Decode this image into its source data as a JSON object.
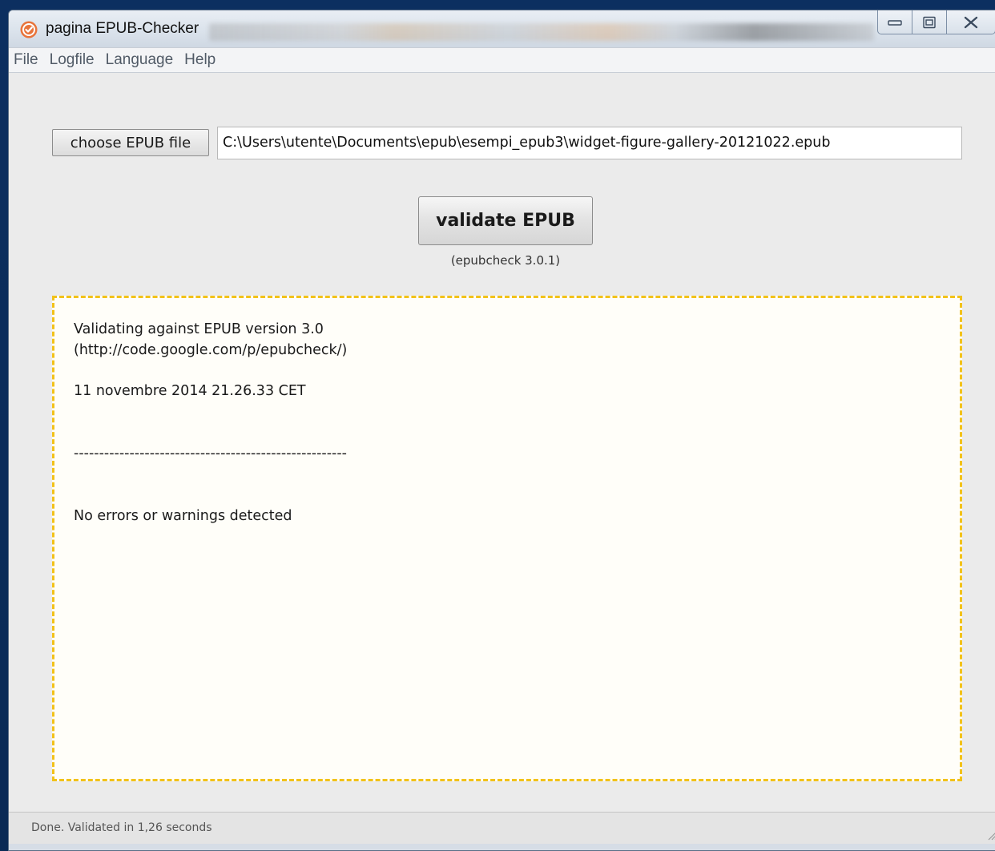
{
  "window": {
    "title": "pagina EPUB-Checker"
  },
  "icons": {
    "app": "epub-checker-logo-icon",
    "minimize": "minimize-icon",
    "maximize": "maximize-icon",
    "close": "close-icon"
  },
  "menu": {
    "items": [
      {
        "label": "File"
      },
      {
        "label": "Logfile"
      },
      {
        "label": "Language"
      },
      {
        "label": "Help"
      }
    ]
  },
  "file_picker": {
    "button_label": "choose EPUB file",
    "path": "C:\\Users\\utente\\Documents\\epub\\esempi_epub3\\widget-figure-gallery-20121022.epub"
  },
  "validate": {
    "button_label": "validate EPUB",
    "version": "(epubcheck 3.0.1)"
  },
  "log": {
    "line1": "Validating against EPUB version 3.0",
    "line2": "(http://code.google.com/p/epubcheck/)",
    "timestamp": "11 novembre 2014 21.26.33 CET",
    "separator": "------------------------------------------------------",
    "result": "No errors or warnings detected"
  },
  "status": {
    "text": "Done. Validated in 1,26 seconds"
  },
  "colors": {
    "log_border": "#f2c21a",
    "log_background": "#fffef9",
    "app_icon": "#e8743b"
  }
}
